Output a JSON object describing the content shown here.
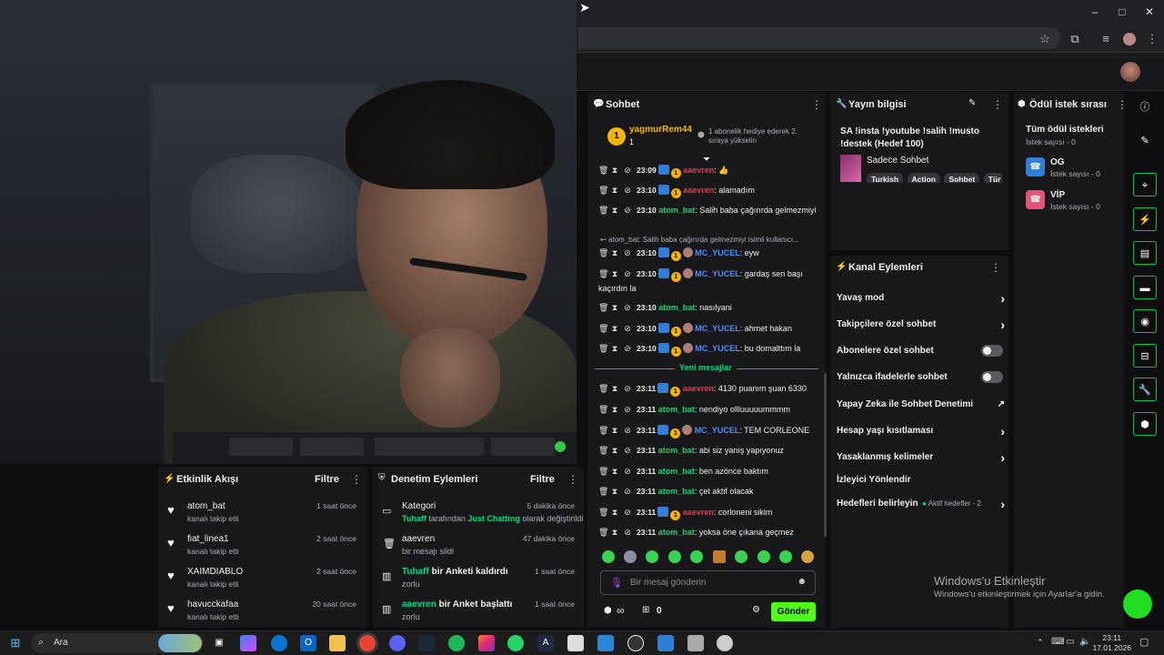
{
  "webcam": {
    "label": "webcam-feed"
  },
  "browser": {
    "window_controls": [
      "–",
      "□",
      "✕"
    ]
  },
  "activity": {
    "title": "Etkinlik Akışı",
    "filter": "Filtre",
    "items": [
      {
        "name": "atom_bat",
        "sub": "kanalı takip etti",
        "time": "1 saat önce"
      },
      {
        "name": "fiat_linea1",
        "sub": "kanalı takip etti",
        "time": "2 saat önce"
      },
      {
        "name": "XAIMDIABLO",
        "sub": "kanalı takip etti",
        "time": "2 saat önce"
      },
      {
        "name": "havucckafaa",
        "sub": "kanalı takip etti",
        "time": "20 saat önce"
      }
    ]
  },
  "moderation": {
    "title": "Denetim Eylemleri",
    "filter": "Filtre",
    "items": [
      {
        "title": "Kategori",
        "time": "5 dakika önce",
        "sub_a": "Tuhaff",
        "sub_b": " tarafından ",
        "sub_c": "Just Chatting",
        "sub_d": " olarak değiştirildi"
      },
      {
        "title": "aaevren",
        "time": "47 dakika önce",
        "sub": "bir mesajı sildi"
      },
      {
        "title_user": "Tuhaff",
        "title_rest": " bir Anketi kaldırdı",
        "time": "1 saat önce",
        "sub": "zorlu"
      },
      {
        "title_user": "aaevren",
        "title_rest": " bir Anket başlattı",
        "time": "1 saat önce",
        "sub": "zorlu"
      }
    ]
  },
  "chat": {
    "title": "Sohbet",
    "pinned_user": "yagmurRem44",
    "pinned_count": "1",
    "pinned_text": "1 abonelik hediye ederek 2. sıraya yükselin",
    "messages": [
      {
        "time": "23:09",
        "user": "aaevren",
        "color": "red",
        "text": ": 👍"
      },
      {
        "time": "23:10",
        "user": "aaevren",
        "color": "red",
        "text": ": alamadım"
      },
      {
        "time": "23:10",
        "user": "atom_bat",
        "color": "green",
        "text": ": Salih baba çağırırda gelmezmiyi"
      },
      {
        "time": "23:10",
        "user": "MC_YUCEL",
        "color": "blue",
        "text": ": eyw"
      },
      {
        "time": "23:10",
        "user": "MC_YUCEL",
        "color": "blue",
        "text": ": gardaş sen başı kaçırdın la"
      },
      {
        "time": "23:10",
        "user": "atom_bat",
        "color": "green",
        "text": ": nasılyani"
      },
      {
        "time": "23:10",
        "user": "MC_YUCEL",
        "color": "blue",
        "text": ": ahmet hakan"
      },
      {
        "time": "23:10",
        "user": "MC_YUCEL",
        "color": "blue",
        "text": ": bu domalttım la"
      },
      {
        "time": "23:11",
        "user": "aaevren",
        "color": "red",
        "text": ": 4130 puanım şuan 6330"
      },
      {
        "time": "23:11",
        "user": "atom_bat",
        "color": "green",
        "text": ": nendiyo ollluuuuummmm"
      },
      {
        "time": "23:11",
        "user": "MC_YUCEL",
        "color": "blue",
        "text": ": TEM CORLEONE"
      },
      {
        "time": "23:11",
        "user": "atom_bat",
        "color": "green",
        "text": ": abi siz yanış yapıyonuz"
      },
      {
        "time": "23:11",
        "user": "atom_bat",
        "color": "green",
        "text": ": ben azönce baktım"
      },
      {
        "time": "23:11",
        "user": "atom_bat",
        "color": "green",
        "text": ": çet aktif olacak"
      },
      {
        "time": "23:11",
        "user": "aaevren",
        "color": "red",
        "text": ": corloneni sikim"
      },
      {
        "time": "23:11",
        "user": "atom_bat",
        "color": "green",
        "text": ": yoksa öne çıkana geçmez"
      }
    ],
    "reply_text": "atom_bat: Salih baba çağırırda gelmezmiyi isimli kullanıcı...",
    "new_messages": "Yeni mesajlar",
    "input_placeholder": "Bir mesaj gönderin",
    "points": "0",
    "infinity": "∞",
    "send": "Gönder"
  },
  "stream_info": {
    "title": "Yayın bilgisi",
    "stream_title": "SA !insta !youtube !salih !musto !destek (Hedef 100)",
    "category": "Sadece Sohbet",
    "tags": [
      "Turkish",
      "Action",
      "Sohbet",
      "Tür"
    ]
  },
  "channel_actions": {
    "title": "Kanal Eylemleri",
    "rows": [
      {
        "label": "Yavaş mod",
        "kind": "chevron"
      },
      {
        "label": "Takipçilere özel sohbet",
        "kind": "chevron"
      },
      {
        "label": "Abonelere özel sohbet",
        "kind": "toggle"
      },
      {
        "label": "Yalnızca ifadelerle sohbet",
        "kind": "toggle"
      },
      {
        "label": "Yapay Zeka ile Sohbet Denetimi",
        "kind": "external"
      },
      {
        "label": "Hesap yaşı kısıtlaması",
        "kind": "chevron"
      },
      {
        "label": "Yasaklanmış kelimeler",
        "kind": "chevron"
      },
      {
        "label": "İzleyici Yönlendir",
        "kind": "none"
      },
      {
        "label": "Hedefleri belirleyin",
        "kind": "goals"
      }
    ],
    "goals_status": "Aktif hedefler - 2"
  },
  "rewards": {
    "title": "Ödül istek sırası",
    "all_title": "Tüm ödül istekleri",
    "all_count": "İstek sayısı - 0",
    "items": [
      {
        "name": "OG",
        "count": "İstek sayısı - 0"
      },
      {
        "name": "VİP",
        "count": "İstek sayısı - 0"
      }
    ]
  },
  "watermark": {
    "line1": "Windows'u Etkinleştir",
    "line2": "Windows'u etkinleştirmek için Ayarlar'a gidin."
  },
  "taskbar": {
    "search": "Ara",
    "clock_time": "23:11",
    "clock_date": "17.01.2026"
  },
  "colors": {
    "accent_green": "#00db84",
    "send_button": "#53fc18",
    "panel_bg": "#18181b",
    "page_bg": "#0e0e10"
  }
}
